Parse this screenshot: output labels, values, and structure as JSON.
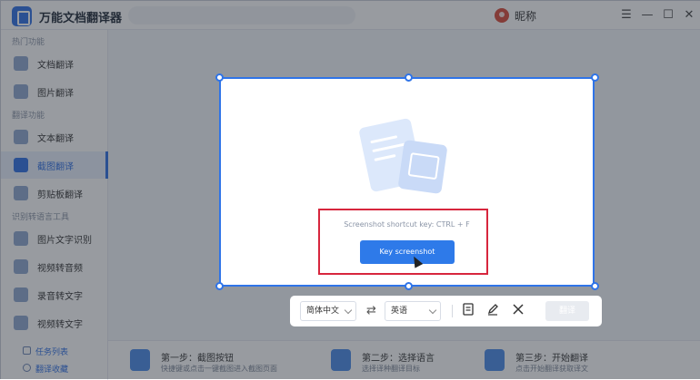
{
  "titlebar": {
    "app_title": "万能文档翻译器",
    "nickname": "昵称",
    "minimize": "—",
    "menu": "☰",
    "maximize": "☐",
    "close": "✕"
  },
  "sidebar": {
    "sections": [
      {
        "label": "热门功能",
        "items": [
          {
            "label": "文档翻译"
          },
          {
            "label": "图片翻译"
          }
        ]
      },
      {
        "label": "翻译功能",
        "items": [
          {
            "label": "文本翻译"
          },
          {
            "label": "截图翻译"
          },
          {
            "label": "剪贴板翻译"
          }
        ]
      },
      {
        "label": "识别转语言工具",
        "items": [
          {
            "label": "图片文字识别"
          },
          {
            "label": "视频转音频"
          },
          {
            "label": "录音转文字"
          },
          {
            "label": "视频转文字"
          }
        ]
      }
    ],
    "active_item": "截图翻译",
    "bottom_links": [
      {
        "label": "任务列表"
      },
      {
        "label": "翻译收藏"
      }
    ]
  },
  "steps": [
    {
      "title": "第一步：截图按钮",
      "desc": "快捷键或点击一键截图进入截图页面"
    },
    {
      "title": "第二步：选择语言",
      "desc": "选择译种翻译目标"
    },
    {
      "title": "第三步：开始翻译",
      "desc": "点击开始翻译获取译文"
    }
  ],
  "capture": {
    "shortcut_hint": "Screenshot shortcut key: CTRL + F",
    "key_button": "Key screenshot"
  },
  "toolbar": {
    "source_lang": "简体中文",
    "swap_icon": "⇄",
    "target_lang": "英语",
    "translate_label": "翻译"
  },
  "colors": {
    "accent": "#2e7ae9",
    "highlight_box": "#d7263d",
    "overlay": "rgba(40,46,56,0.48)"
  }
}
